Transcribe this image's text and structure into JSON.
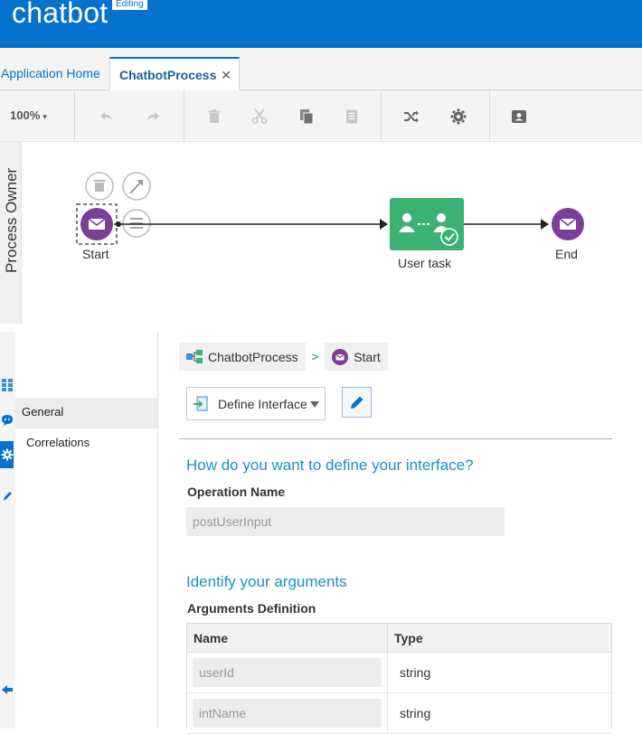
{
  "app": {
    "title": "chatbot",
    "badge": "Editing"
  },
  "tabs": [
    {
      "label": "Application Home"
    },
    {
      "label": "ChatbotProcess",
      "close": "✕"
    }
  ],
  "toolbar": {
    "zoom": "100%",
    "icons": [
      "undo-icon",
      "redo-icon",
      "delete-icon",
      "cut-icon",
      "copy-icon",
      "paste-icon",
      "shuffle-icon",
      "gear-icon",
      "contact-card-icon"
    ]
  },
  "canvas": {
    "lane_label": "Process Owner",
    "nodes": [
      {
        "label": "Start",
        "type": "message-start"
      },
      {
        "label": "User task",
        "type": "user-task"
      },
      {
        "label": "End",
        "type": "message-end"
      }
    ],
    "colors": {
      "event": "#7b3f98",
      "task": "#3bb273"
    }
  },
  "side_nav": {
    "items": [
      {
        "label": "General"
      },
      {
        "label": "Correlations"
      }
    ]
  },
  "props": {
    "breadcrumb": [
      {
        "label": "ChatbotProcess"
      },
      {
        "label": "Start"
      }
    ],
    "breadcrumb_sep": ">",
    "interface_select": "Define Interface",
    "section1_title": "How do you want to define your interface?",
    "operation_label": "Operation Name",
    "operation_placeholder": "postUserInput",
    "section2_title": "Identify your arguments",
    "args_label": "Arguments Definition",
    "args_columns": [
      "Name",
      "Type"
    ],
    "args_rows": [
      {
        "name": "userId",
        "type": "string"
      },
      {
        "name": "intName",
        "type": "string"
      }
    ]
  }
}
